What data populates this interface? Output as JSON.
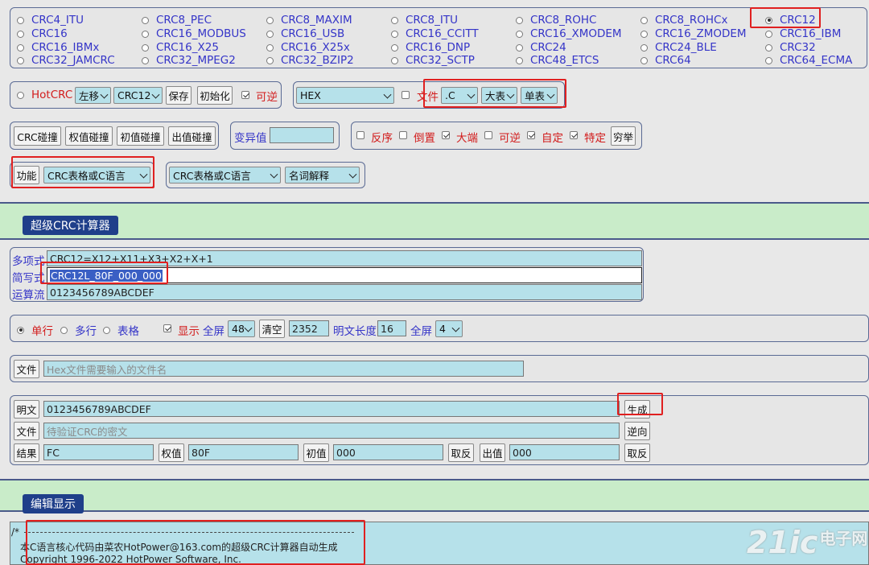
{
  "crc_types": [
    [
      "CRC4_ITU",
      "CRC8_PEC",
      "CRC8_MAXIM",
      "CRC8_ITU",
      "CRC8_ROHC",
      "CRC8_ROHCx",
      "CRC12"
    ],
    [
      "CRC16",
      "CRC16_MODBUS",
      "CRC16_USB",
      "CRC16_CCITT",
      "CRC16_XMODEM",
      "CRC16_ZMODEM",
      "CRC16_IBM"
    ],
    [
      "CRC16_IBMx",
      "CRC16_X25",
      "CRC16_X25x",
      "CRC16_DNP",
      "CRC24",
      "CRC24_BLE",
      "CRC32"
    ],
    [
      "CRC32_JAMCRC",
      "CRC32_MPEG2",
      "CRC32_BZIP2",
      "CRC32_SCTP",
      "CRC48_ETCS",
      "CRC64",
      "CRC64_ECMA"
    ]
  ],
  "selected_crc": "CRC12",
  "hotcrc": {
    "label": "HotCRC",
    "shift_select": "左移",
    "crc_select": "CRC12",
    "save": "保存",
    "init": "初始化",
    "reversible": "可逆",
    "reversible_checked": true
  },
  "format": {
    "format_select": "HEX",
    "file_label": "文件",
    "file_checked": false,
    "ext_select": ".C",
    "table_size_select": "大表",
    "table_type_select": "单表"
  },
  "collision": {
    "crc_collision": "CRC碰撞",
    "weight_collision": "权值碰撞",
    "init_collision": "初值碰撞",
    "out_collision": "出值碰撞"
  },
  "variant": {
    "label": "变异值",
    "value": ""
  },
  "options": [
    {
      "label": "反序",
      "checked": false
    },
    {
      "label": "倒置",
      "checked": false
    },
    {
      "label": "大端",
      "checked": true
    },
    {
      "label": "可逆",
      "checked": false
    },
    {
      "label": "自定",
      "checked": true
    },
    {
      "label": "特定",
      "checked": true
    }
  ],
  "enumerate_button": "穷举",
  "function": {
    "button": "功能",
    "select": "CRC表格或C语言",
    "select2": "CRC表格或C语言",
    "select3": "名词解释"
  },
  "calculator": {
    "title": "超级CRC计算器",
    "poly_label": "多项式",
    "poly_value": "CRC12=X12+X11+X3+X2+X+1",
    "short_label": "简写式",
    "short_value": "CRC12L_80F_000_000",
    "stream_label": "运算流",
    "stream_value": "0123456789ABCDEF"
  },
  "display": {
    "single_line": "单行",
    "multi_line": "多行",
    "table": "表格",
    "show_label": "显示",
    "show_checked": true,
    "fullscreen1_label": "全屏",
    "fullscreen1_value": "48",
    "clear": "清空",
    "count_value": "2352",
    "plain_len_label": "明文长度",
    "plain_len_value": "16",
    "fullscreen2_label": "全屏",
    "fullscreen2_value": "4"
  },
  "file_row": {
    "button": "文件",
    "placeholder": "Hex文件需要输入的文件名"
  },
  "io": {
    "plain_button": "明文",
    "plain_value": "0123456789ABCDEF",
    "generate_button": "生成",
    "cipher_file_button": "文件",
    "cipher_placeholder": "待验证CRC的密文",
    "reverse_button": "逆向",
    "result_button": "结果",
    "result_value": "FC",
    "weight_button": "权值",
    "weight_value": "80F",
    "init_button": "初值",
    "init_value": "000",
    "neg1_button": "取反",
    "out_button": "出值",
    "out_value": "000",
    "neg2_button": "取反"
  },
  "editor": {
    "title": "编辑显示",
    "line1": "/*",
    "line2": "本C语言核心代码由菜农HotPower@163.com的超级CRC计算器自动生成",
    "line3": "Copyright 1996-2022 HotPower Software, Inc."
  },
  "watermark": {
    "text": "21ic",
    "suffix": "电子网"
  }
}
